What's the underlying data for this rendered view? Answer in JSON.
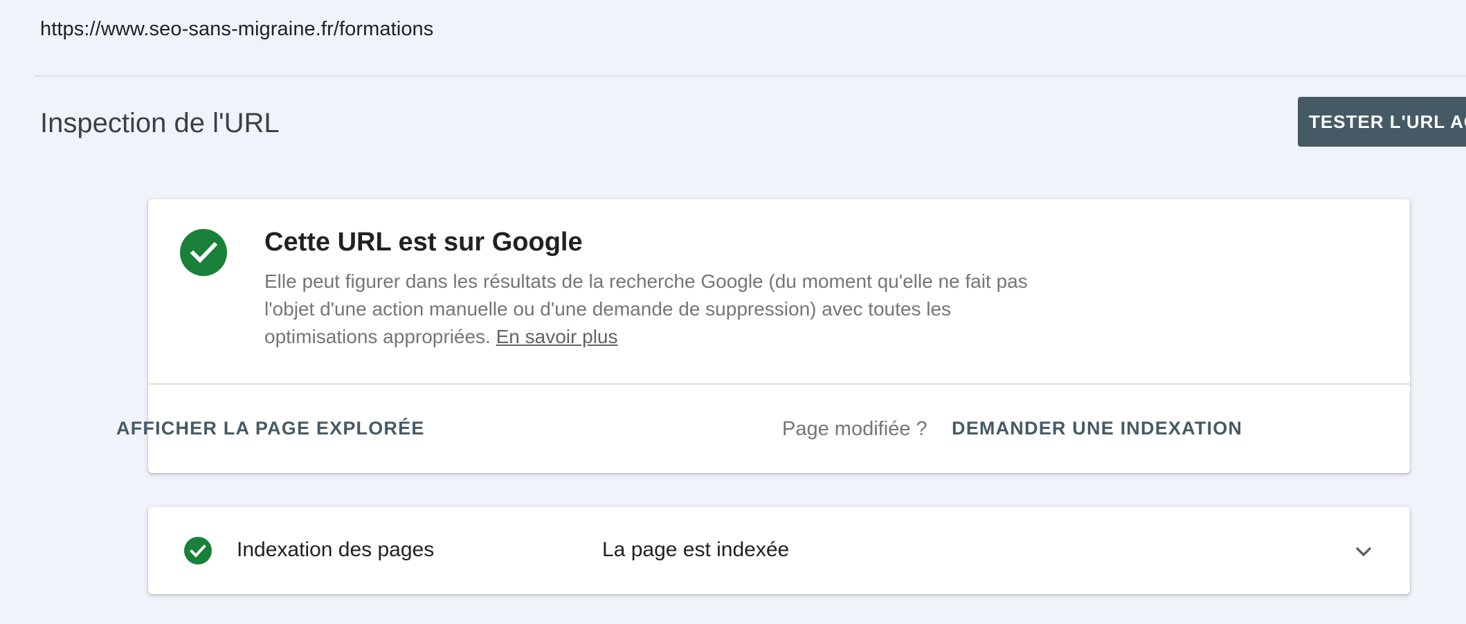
{
  "url": "https://www.seo-sans-migraine.fr/formations",
  "page_title": "Inspection de l'URL",
  "test_live_button": "TESTER L'URL ACTIVE",
  "status_card": {
    "icon": "check-circle-icon",
    "title": "Cette URL est sur Google",
    "description": "Elle peut figurer dans les résultats de la recherche Google (du moment qu'elle ne fait pas l'objet d'une action manuelle ou d'une demande de suppression) avec toutes les optimisations appropriées.",
    "learn_more": "En savoir plus",
    "view_crawled_page": "AFFICHER LA PAGE EXPLORÉE",
    "page_modified": "Page modifiée ?",
    "request_indexing": "DEMANDER UNE INDEXATION"
  },
  "indexing_card": {
    "icon": "check-circle-icon",
    "label": "Indexation des pages",
    "value": "La page est indexée",
    "expand_icon": "chevron-down-icon"
  },
  "colors": {
    "background": "#f0f4fa",
    "success_green": "#188038",
    "button_slate": "#455a64"
  }
}
